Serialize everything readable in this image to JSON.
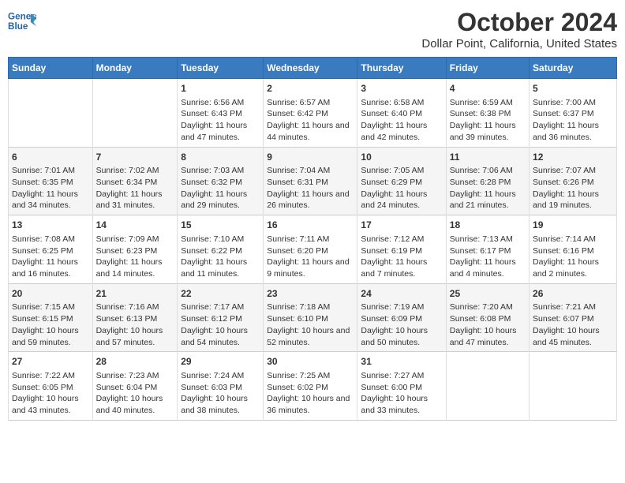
{
  "header": {
    "logo_line1": "General",
    "logo_line2": "Blue",
    "main_title": "October 2024",
    "subtitle": "Dollar Point, California, United States"
  },
  "days_of_week": [
    "Sunday",
    "Monday",
    "Tuesday",
    "Wednesday",
    "Thursday",
    "Friday",
    "Saturday"
  ],
  "weeks": [
    [
      {
        "day": "",
        "sunrise": "",
        "sunset": "",
        "daylight": ""
      },
      {
        "day": "",
        "sunrise": "",
        "sunset": "",
        "daylight": ""
      },
      {
        "day": "1",
        "sunrise": "Sunrise: 6:56 AM",
        "sunset": "Sunset: 6:43 PM",
        "daylight": "Daylight: 11 hours and 47 minutes."
      },
      {
        "day": "2",
        "sunrise": "Sunrise: 6:57 AM",
        "sunset": "Sunset: 6:42 PM",
        "daylight": "Daylight: 11 hours and 44 minutes."
      },
      {
        "day": "3",
        "sunrise": "Sunrise: 6:58 AM",
        "sunset": "Sunset: 6:40 PM",
        "daylight": "Daylight: 11 hours and 42 minutes."
      },
      {
        "day": "4",
        "sunrise": "Sunrise: 6:59 AM",
        "sunset": "Sunset: 6:38 PM",
        "daylight": "Daylight: 11 hours and 39 minutes."
      },
      {
        "day": "5",
        "sunrise": "Sunrise: 7:00 AM",
        "sunset": "Sunset: 6:37 PM",
        "daylight": "Daylight: 11 hours and 36 minutes."
      }
    ],
    [
      {
        "day": "6",
        "sunrise": "Sunrise: 7:01 AM",
        "sunset": "Sunset: 6:35 PM",
        "daylight": "Daylight: 11 hours and 34 minutes."
      },
      {
        "day": "7",
        "sunrise": "Sunrise: 7:02 AM",
        "sunset": "Sunset: 6:34 PM",
        "daylight": "Daylight: 11 hours and 31 minutes."
      },
      {
        "day": "8",
        "sunrise": "Sunrise: 7:03 AM",
        "sunset": "Sunset: 6:32 PM",
        "daylight": "Daylight: 11 hours and 29 minutes."
      },
      {
        "day": "9",
        "sunrise": "Sunrise: 7:04 AM",
        "sunset": "Sunset: 6:31 PM",
        "daylight": "Daylight: 11 hours and 26 minutes."
      },
      {
        "day": "10",
        "sunrise": "Sunrise: 7:05 AM",
        "sunset": "Sunset: 6:29 PM",
        "daylight": "Daylight: 11 hours and 24 minutes."
      },
      {
        "day": "11",
        "sunrise": "Sunrise: 7:06 AM",
        "sunset": "Sunset: 6:28 PM",
        "daylight": "Daylight: 11 hours and 21 minutes."
      },
      {
        "day": "12",
        "sunrise": "Sunrise: 7:07 AM",
        "sunset": "Sunset: 6:26 PM",
        "daylight": "Daylight: 11 hours and 19 minutes."
      }
    ],
    [
      {
        "day": "13",
        "sunrise": "Sunrise: 7:08 AM",
        "sunset": "Sunset: 6:25 PM",
        "daylight": "Daylight: 11 hours and 16 minutes."
      },
      {
        "day": "14",
        "sunrise": "Sunrise: 7:09 AM",
        "sunset": "Sunset: 6:23 PM",
        "daylight": "Daylight: 11 hours and 14 minutes."
      },
      {
        "day": "15",
        "sunrise": "Sunrise: 7:10 AM",
        "sunset": "Sunset: 6:22 PM",
        "daylight": "Daylight: 11 hours and 11 minutes."
      },
      {
        "day": "16",
        "sunrise": "Sunrise: 7:11 AM",
        "sunset": "Sunset: 6:20 PM",
        "daylight": "Daylight: 11 hours and 9 minutes."
      },
      {
        "day": "17",
        "sunrise": "Sunrise: 7:12 AM",
        "sunset": "Sunset: 6:19 PM",
        "daylight": "Daylight: 11 hours and 7 minutes."
      },
      {
        "day": "18",
        "sunrise": "Sunrise: 7:13 AM",
        "sunset": "Sunset: 6:17 PM",
        "daylight": "Daylight: 11 hours and 4 minutes."
      },
      {
        "day": "19",
        "sunrise": "Sunrise: 7:14 AM",
        "sunset": "Sunset: 6:16 PM",
        "daylight": "Daylight: 11 hours and 2 minutes."
      }
    ],
    [
      {
        "day": "20",
        "sunrise": "Sunrise: 7:15 AM",
        "sunset": "Sunset: 6:15 PM",
        "daylight": "Daylight: 10 hours and 59 minutes."
      },
      {
        "day": "21",
        "sunrise": "Sunrise: 7:16 AM",
        "sunset": "Sunset: 6:13 PM",
        "daylight": "Daylight: 10 hours and 57 minutes."
      },
      {
        "day": "22",
        "sunrise": "Sunrise: 7:17 AM",
        "sunset": "Sunset: 6:12 PM",
        "daylight": "Daylight: 10 hours and 54 minutes."
      },
      {
        "day": "23",
        "sunrise": "Sunrise: 7:18 AM",
        "sunset": "Sunset: 6:10 PM",
        "daylight": "Daylight: 10 hours and 52 minutes."
      },
      {
        "day": "24",
        "sunrise": "Sunrise: 7:19 AM",
        "sunset": "Sunset: 6:09 PM",
        "daylight": "Daylight: 10 hours and 50 minutes."
      },
      {
        "day": "25",
        "sunrise": "Sunrise: 7:20 AM",
        "sunset": "Sunset: 6:08 PM",
        "daylight": "Daylight: 10 hours and 47 minutes."
      },
      {
        "day": "26",
        "sunrise": "Sunrise: 7:21 AM",
        "sunset": "Sunset: 6:07 PM",
        "daylight": "Daylight: 10 hours and 45 minutes."
      }
    ],
    [
      {
        "day": "27",
        "sunrise": "Sunrise: 7:22 AM",
        "sunset": "Sunset: 6:05 PM",
        "daylight": "Daylight: 10 hours and 43 minutes."
      },
      {
        "day": "28",
        "sunrise": "Sunrise: 7:23 AM",
        "sunset": "Sunset: 6:04 PM",
        "daylight": "Daylight: 10 hours and 40 minutes."
      },
      {
        "day": "29",
        "sunrise": "Sunrise: 7:24 AM",
        "sunset": "Sunset: 6:03 PM",
        "daylight": "Daylight: 10 hours and 38 minutes."
      },
      {
        "day": "30",
        "sunrise": "Sunrise: 7:25 AM",
        "sunset": "Sunset: 6:02 PM",
        "daylight": "Daylight: 10 hours and 36 minutes."
      },
      {
        "day": "31",
        "sunrise": "Sunrise: 7:27 AM",
        "sunset": "Sunset: 6:00 PM",
        "daylight": "Daylight: 10 hours and 33 minutes."
      },
      {
        "day": "",
        "sunrise": "",
        "sunset": "",
        "daylight": ""
      },
      {
        "day": "",
        "sunrise": "",
        "sunset": "",
        "daylight": ""
      }
    ]
  ]
}
